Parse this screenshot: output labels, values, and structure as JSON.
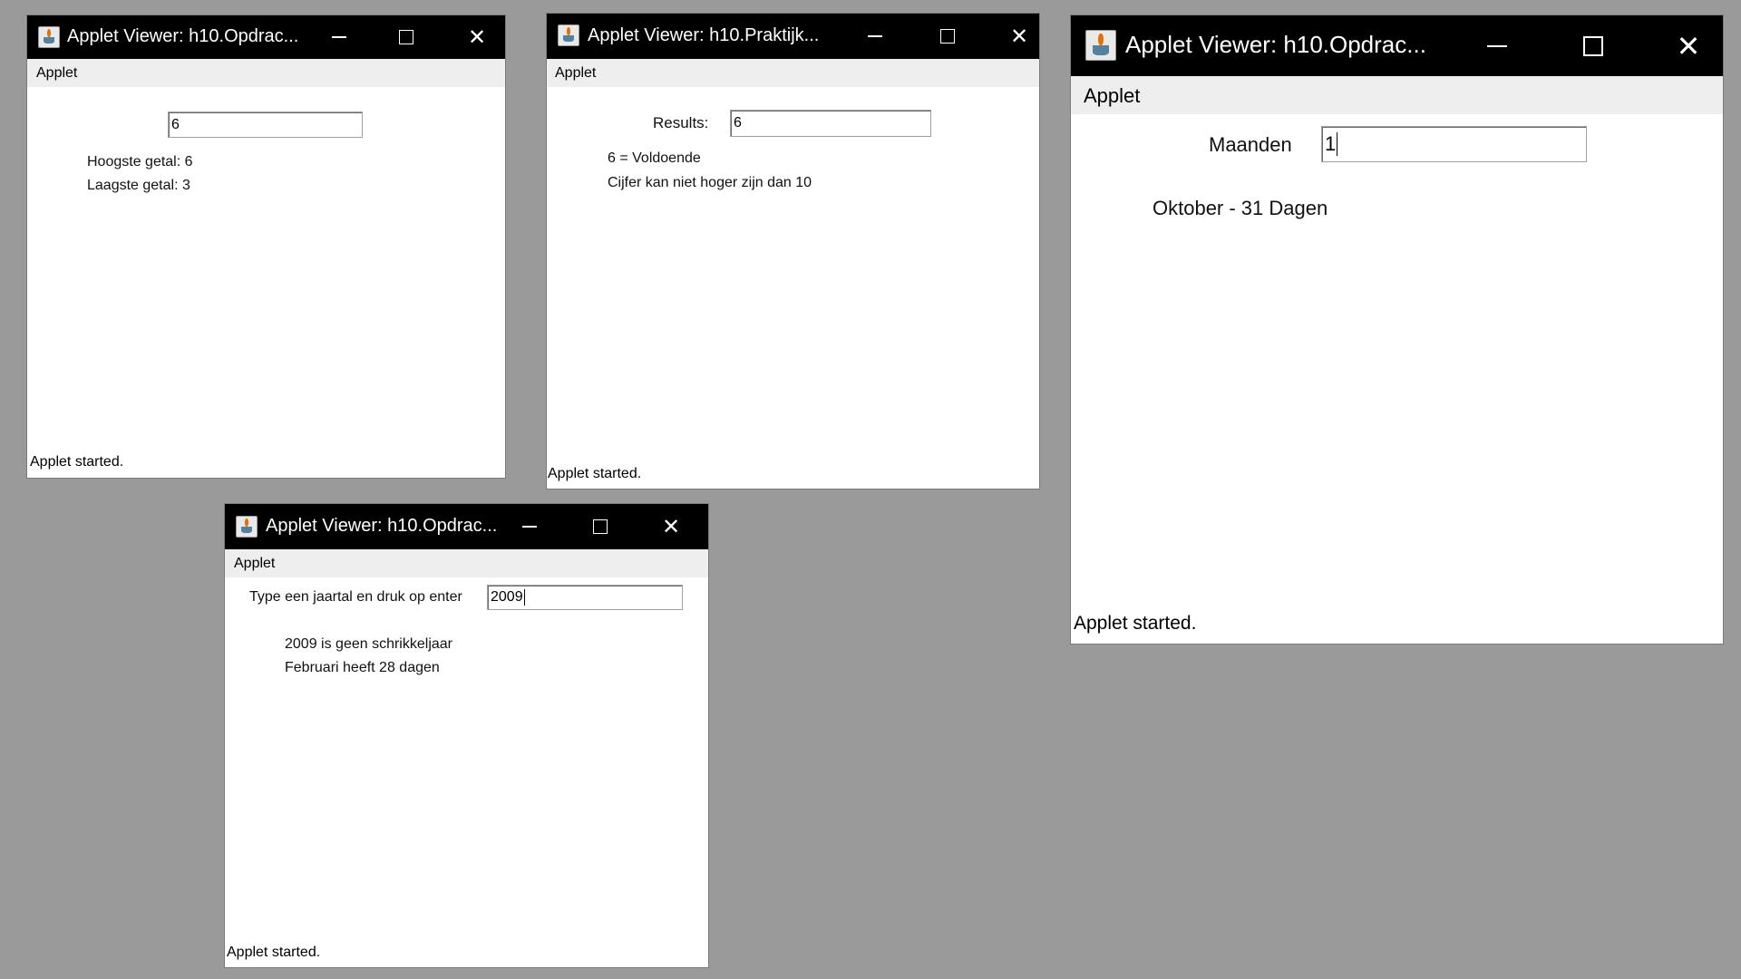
{
  "windows": [
    {
      "title": "Applet Viewer: h10.Opdrac...",
      "menu": "Applet",
      "input_value": "6",
      "lines": [
        "Hoogste getal: 6",
        "Laagste getal: 3"
      ],
      "status": "Applet started."
    },
    {
      "title": "Applet Viewer: h10.Praktijk...",
      "menu": "Applet",
      "input_label": "Results:",
      "input_value": "6",
      "lines": [
        "6 = Voldoende",
        "Cijfer kan niet hoger zijn dan 10"
      ],
      "status": "Applet started."
    },
    {
      "title": "Applet Viewer: h10.Opdrac...",
      "menu": "Applet",
      "input_label": "Maanden",
      "input_value": "1",
      "lines": [
        "Oktober - 31 Dagen"
      ],
      "status": "Applet started."
    },
    {
      "title": "Applet Viewer: h10.Opdrac...",
      "menu": "Applet",
      "input_label": "Type een jaartal en druk op enter",
      "input_value": "2009",
      "lines": [
        "2009 is geen schrikkeljaar",
        "Februari heeft 28 dagen"
      ],
      "status": "Applet started."
    }
  ],
  "icons": {
    "app": "java-icon",
    "minimize": "minimize-icon",
    "maximize": "maximize-icon",
    "close": "close-icon"
  },
  "colors": {
    "desktop": "#9a9a9a",
    "titlebar": "#000000",
    "menubar": "#eeeeee",
    "content": "#ffffff"
  }
}
